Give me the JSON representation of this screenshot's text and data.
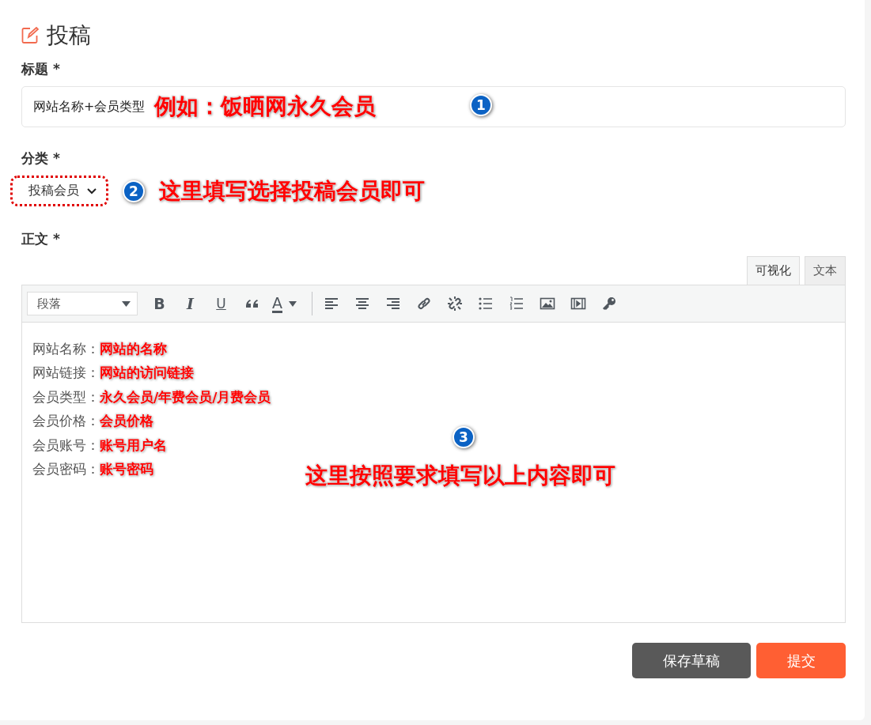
{
  "page_title": "投稿",
  "title_field": {
    "label": "标题 *",
    "value": "网站名称+会员类型",
    "note": "例如：饭晒网永久会员",
    "marker": "1"
  },
  "category": {
    "label": "分类 *",
    "value": "投稿会员",
    "note": "这里填写选择投稿会员即可",
    "marker": "2"
  },
  "body": {
    "label": "正文 *",
    "tabs": [
      {
        "label": "可视化",
        "selected": true
      },
      {
        "label": "文本",
        "selected": false
      }
    ],
    "format_select": "段落",
    "toolbar": [
      {
        "kind": "bold",
        "label": "B"
      },
      {
        "kind": "italic",
        "label": "I"
      },
      {
        "kind": "underline",
        "label": "U"
      },
      {
        "kind": "quote"
      },
      {
        "kind": "text-color",
        "label": "A"
      },
      {
        "kind": "separator"
      },
      {
        "kind": "align-left"
      },
      {
        "kind": "align-center"
      },
      {
        "kind": "align-right"
      },
      {
        "kind": "link"
      },
      {
        "kind": "unlink"
      },
      {
        "kind": "bullet-list"
      },
      {
        "kind": "numbered-list"
      },
      {
        "kind": "image"
      },
      {
        "kind": "video"
      },
      {
        "kind": "key"
      }
    ],
    "lines": [
      {
        "label": "网站名称：",
        "note": "网站的名称"
      },
      {
        "label": "网站链接：",
        "note": "网站的访问链接"
      },
      {
        "label": "会员类型：",
        "note": "永久会员/年费会员/月费会员"
      },
      {
        "label": "会员价格：",
        "note": "会员价格"
      },
      {
        "label": "会员账号：",
        "note": "账号用户名"
      },
      {
        "label": "会员密码：",
        "note": "账号密码"
      }
    ],
    "marker": "3",
    "note": "这里按照要求填写以上内容即可"
  },
  "buttons": [
    {
      "label": "保存草稿",
      "kind": "secondary"
    },
    {
      "label": "提交",
      "kind": "primary"
    }
  ]
}
